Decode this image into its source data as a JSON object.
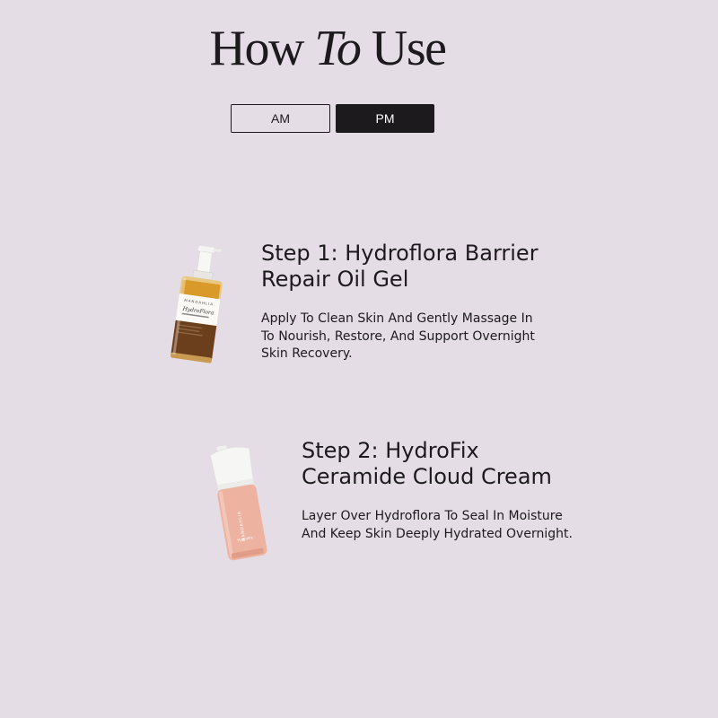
{
  "header": {
    "title_part1": "How ",
    "title_italic": "To",
    "title_part2": " Use"
  },
  "tabs": [
    {
      "label": "AM",
      "active": false
    },
    {
      "label": "PM",
      "active": true
    }
  ],
  "steps": [
    {
      "title": "Step 1: Hydroflora Barrier Repair Oil Gel",
      "description": "Apply To Clean Skin And Gently Massage In To Nourish, Restore, And Support Overnight Skin Recovery.",
      "product_image": {
        "brand": "MANDAHLIA",
        "name": "HydroFlora",
        "type": "dropper-bottle"
      }
    },
    {
      "title": "Step 2: HydroFix Ceramide Cloud Cream",
      "description": "Layer Over Hydroflora To Seal In Moisture And Keep Skin Deeply Hydrated Overnight.",
      "product_image": {
        "name": "HydroFix Ceramide Cloud Cream",
        "type": "pump-tube"
      }
    }
  ],
  "colors": {
    "background": "#e4dde5",
    "text": "#1c1a1d",
    "active_tab_bg": "#1c1a1d",
    "active_tab_text": "#ffffff"
  }
}
